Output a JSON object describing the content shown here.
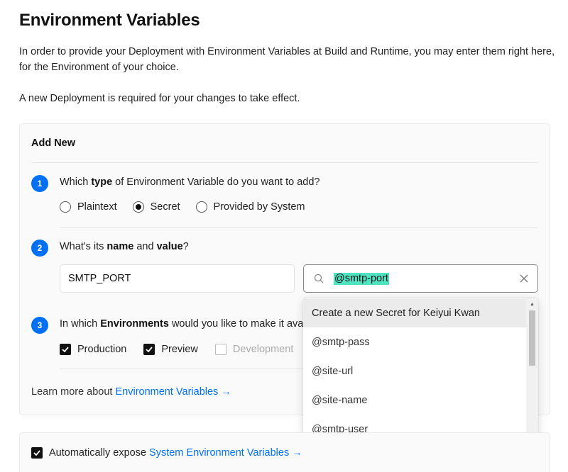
{
  "page": {
    "title": "Environment Variables",
    "description_1": "In order to provide your Deployment with Environment Variables at Build and Runtime, you may enter them right here, for the Environment of your choice.",
    "description_2": "A new Deployment is required for your changes to take effect."
  },
  "add_new": {
    "title": "Add New",
    "step1": {
      "number": "1",
      "q_pre": "Which ",
      "q_bold": "type",
      "q_post": " of Environment Variable do you want to add?",
      "options": [
        {
          "label": "Plaintext",
          "selected": false
        },
        {
          "label": "Secret",
          "selected": true
        },
        {
          "label": "Provided by System",
          "selected": false
        }
      ]
    },
    "step2": {
      "number": "2",
      "q_pre": "What's its ",
      "q_bold1": "name",
      "q_mid": " and ",
      "q_bold2": "value",
      "q_post": "?",
      "name_value": "SMTP_PORT",
      "secret_value": "@smtp-port"
    },
    "step3": {
      "number": "3",
      "q_pre": "In which ",
      "q_bold": "Environments",
      "q_post": " would you like to make it ava",
      "environments": [
        {
          "label": "Production",
          "checked": true
        },
        {
          "label": "Preview",
          "checked": true
        },
        {
          "label": "Development",
          "checked": false
        }
      ]
    },
    "learn_more_prefix": "Learn more about ",
    "learn_more_link": "Environment Variables →"
  },
  "dropdown": {
    "items": [
      "Create a new Secret for Keiyui Kwan",
      "@smtp-pass",
      "@site-url",
      "@site-name",
      "@smtp-user"
    ],
    "active_index": 0
  },
  "system_env": {
    "checked": true,
    "prefix": "Automatically expose ",
    "link": "System Environment Variables →"
  },
  "colors": {
    "accent": "#0070f3",
    "highlight": "#50e3c2"
  }
}
